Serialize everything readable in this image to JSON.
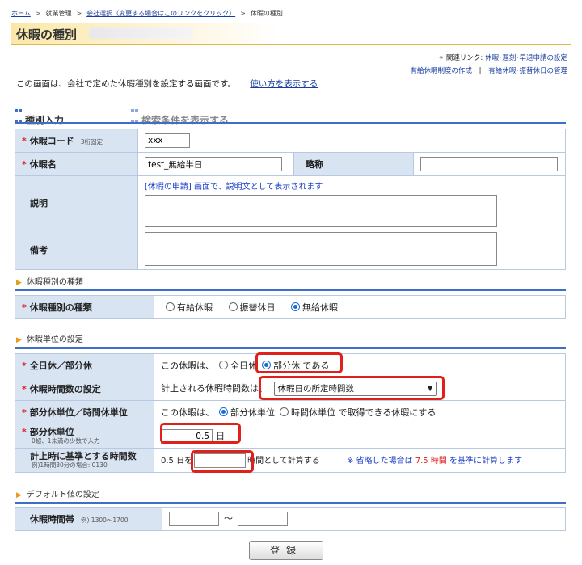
{
  "breadcrumb": {
    "home": "ホーム",
    "work": "就業管理",
    "company": "会社選択（変更する場合はこのリンクをクリック）",
    "current": "休暇の種別"
  },
  "page_title": "休暇の種別",
  "related": {
    "label": "関連リンク:",
    "link1": "休暇･遅刻･早退申請の設定",
    "link2": "有給休暇制度の作成",
    "sep": "|",
    "link3": "有給休暇･振替休日の管理"
  },
  "intro": {
    "text": "この画面は、会社で定めた休暇種別を設定する画面です。",
    "link": "使い方を表示する"
  },
  "sections": {
    "input": "種別入力",
    "search": "検索条件を表示する"
  },
  "form1": {
    "code_label": "休暇コード",
    "code_sub": "3桁固定",
    "code_value": "xxx",
    "name_label": "休暇名",
    "name_value": "test_無給半日",
    "abbr_label": "略称",
    "abbr_value": "",
    "desc_label": "説明",
    "desc_note": "[休暇の申請] 画面で、説明文として表示されます",
    "remark_label": "備考"
  },
  "sub1": "休暇種別の種類",
  "form2": {
    "label": "休暇種別の種類",
    "opts": [
      "有給休暇",
      "振替休日",
      "無給休暇"
    ],
    "selected": 2
  },
  "sub2": "休暇単位の設定",
  "form3": {
    "r1_label": "全日休／部分休",
    "r1_pre": "この休暇は、",
    "r1_opt1": "全日休",
    "r1_opt2": "部分休 である",
    "r2_label": "休暇時間数の設定",
    "r2_pre": "計上される休暇時間数は、",
    "r2_select": "休暇日の所定時間数",
    "r3_label": "部分休単位／時間休単位",
    "r3_pre": "この休暇は、",
    "r3_opt1": "部分休単位",
    "r3_opt2": "時間休単位",
    "r3_post": "で取得できる休暇にする",
    "r4_label": "部分休単位",
    "r4_sub": "0超、1未満の少数で入力",
    "r4_value": "0.5",
    "r4_unit": "日",
    "r5_label": "計上時に基準とする時間数",
    "r5_sub": "例)1時間30分の場合: 0130",
    "r5_pre": "0.5 日を",
    "r5_value": "",
    "r5_post": "時間として計算する",
    "r5_note_pre": "※ 省略した場合は",
    "r5_note_val": "7.5 時間",
    "r5_note_post": "を基準に計算します"
  },
  "sub3": "デフォルト値の設定",
  "form4": {
    "label": "休暇時間帯",
    "sub": "例) 1300～1700",
    "from": "",
    "tilde": "～",
    "to": ""
  },
  "submit": "登録",
  "colors": {
    "accent": "#3d6fc8",
    "label_bg": "#d9e4f3",
    "highlight": "#e0201a"
  }
}
